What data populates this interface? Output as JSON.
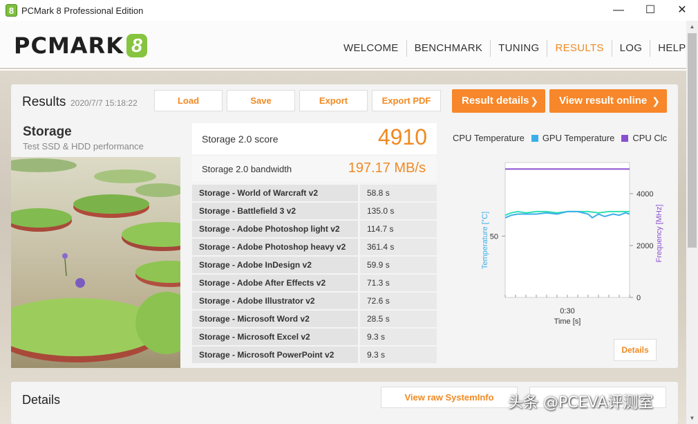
{
  "window": {
    "title": "PCMark 8 Professional Edition",
    "icon_glyph": "8",
    "minimize": "—",
    "maximize": "☐",
    "close": "✕"
  },
  "logo": {
    "word": "PCMARK",
    "badge": "8"
  },
  "nav": [
    "WELCOME",
    "BENCHMARK",
    "TUNING",
    "RESULTS",
    "LOG",
    "HELP"
  ],
  "nav_active": "RESULTS",
  "results": {
    "title": "Results",
    "date": "2020/7/7 15:18:22",
    "buttons": {
      "load": "Load",
      "save": "Save",
      "export": "Export",
      "export_pdf": "Export PDF",
      "result_details": "Result details",
      "view_online": "View result online",
      "chevron": "❯"
    }
  },
  "storage": {
    "name": "Storage",
    "description": "Test SSD & HDD performance"
  },
  "score": {
    "label": "Storage 2.0 score",
    "value": "4910"
  },
  "bandwidth": {
    "label": "Storage 2.0 bandwidth",
    "value": "197.17 MB/s"
  },
  "tests": [
    {
      "name": "Storage - World of Warcraft v2",
      "value": "58.8 s"
    },
    {
      "name": "Storage - Battlefield 3 v2",
      "value": "135.0 s"
    },
    {
      "name": "Storage - Adobe Photoshop light v2",
      "value": "114.7 s"
    },
    {
      "name": "Storage - Adobe Photoshop heavy v2",
      "value": "361.4 s"
    },
    {
      "name": "Storage - Adobe InDesign v2",
      "value": "59.9 s"
    },
    {
      "name": "Storage - Adobe After Effects v2",
      "value": "71.3 s"
    },
    {
      "name": "Storage - Adobe Illustrator v2",
      "value": "72.6 s"
    },
    {
      "name": "Storage - Microsoft Word v2",
      "value": "28.5 s"
    },
    {
      "name": "Storage - Microsoft Excel v2",
      "value": "9.3 s"
    },
    {
      "name": "Storage - Microsoft PowerPoint v2",
      "value": "9.3 s"
    }
  ],
  "monitor": {
    "legend": [
      {
        "name": "CPU Temperature",
        "color": "#2ee0b0"
      },
      {
        "name": "GPU Temperature",
        "color": "#3aaeea"
      },
      {
        "name": "CPU Clc",
        "color": "#8a4fd0"
      }
    ],
    "left_axis_label": "Temperature [°C]",
    "right_axis_label": "Frequency [MHz]",
    "left_ticks": [
      "50"
    ],
    "right_ticks": [
      "4000",
      "2000",
      "0"
    ],
    "x_tick": "0:30",
    "x_label": "Time [s]",
    "details": "Details"
  },
  "details_section": {
    "title": "Details",
    "button": "View raw SystemInfo"
  },
  "watermark": "头条 @PCEVA评测室",
  "colors": {
    "accent": "#f08a24",
    "button_orange": "#f7872a"
  },
  "chart_data": {
    "type": "line",
    "xlabel": "Time [s]",
    "ylabel": "Temperature [°C]",
    "y2label": "Frequency [MHz]",
    "x_ticks": [
      "0:30"
    ],
    "xlim": [
      0,
      60
    ],
    "y2lim": [
      0,
      5200
    ],
    "ylim": [
      0,
      110
    ],
    "series": [
      {
        "name": "CPU Temperature",
        "axis": "left",
        "color": "#2ee0b0",
        "x": [
          0,
          3,
          6,
          10,
          15,
          20,
          25,
          30,
          35,
          40,
          45,
          50,
          55,
          60
        ],
        "y": [
          67,
          69,
          70,
          69,
          70,
          70,
          69,
          70,
          70,
          70,
          69,
          70,
          70,
          70
        ]
      },
      {
        "name": "GPU Temperature",
        "axis": "left",
        "color": "#3aaeea",
        "x": [
          0,
          3,
          6,
          10,
          15,
          20,
          25,
          30,
          35,
          40,
          42,
          45,
          48,
          52,
          55,
          58,
          60
        ],
        "y": [
          65,
          67,
          68,
          68,
          68,
          69,
          68,
          70,
          70,
          68,
          65,
          68,
          66,
          68,
          67,
          69,
          68
        ]
      },
      {
        "name": "CPU Clc",
        "axis": "right",
        "color": "#8a4fd0",
        "x": [
          0,
          60
        ],
        "y": [
          4950,
          4950
        ]
      }
    ]
  }
}
